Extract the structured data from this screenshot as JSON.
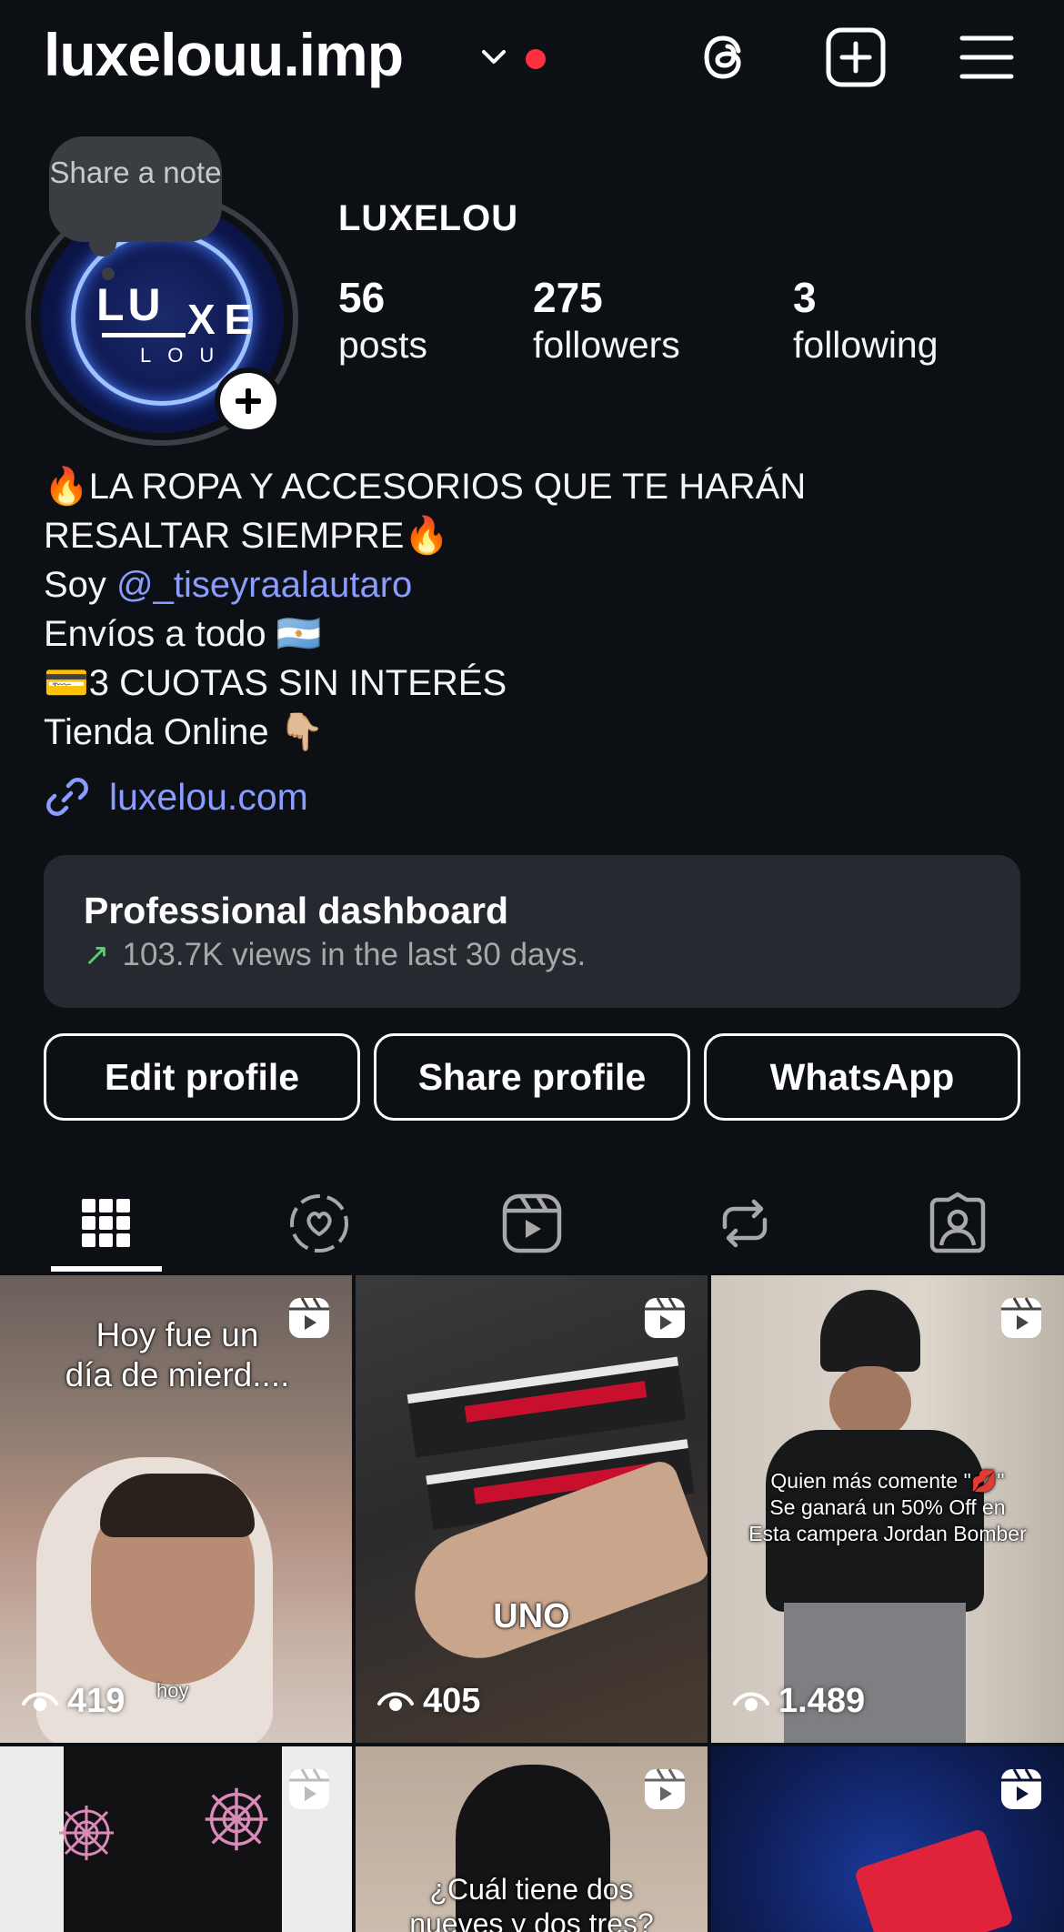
{
  "header": {
    "username": "luxelouu.imp",
    "icons": [
      "threads-icon",
      "create-post-icon",
      "menu-icon"
    ]
  },
  "note": {
    "text": "Share a note"
  },
  "avatar": {
    "logo_top": "LU",
    "logo_right": "XE",
    "logo_bottom": "LOU"
  },
  "profile": {
    "display_name": "LUXELOU",
    "stats": [
      {
        "value": "56",
        "label": "posts"
      },
      {
        "value": "275",
        "label": "followers"
      },
      {
        "value": "3",
        "label": "following"
      }
    ]
  },
  "bio": {
    "line1": "🔥LA ROPA Y ACCESORIOS QUE TE HARÁN",
    "line2": "RESALTAR SIEMPRE🔥",
    "line3_prefix": "Soy ",
    "mention": "@_tiseyraalautaro",
    "line4": "Envíos a todo 🇦🇷",
    "line5": "💳3 CUOTAS SIN INTERÉS",
    "line6": "Tienda Online 👇🏼",
    "link": "luxelou.com"
  },
  "dashboard": {
    "title": "Professional dashboard",
    "subtitle": "103.7K views in the last 30 days.",
    "accent": "#4fd46b"
  },
  "buttons": {
    "edit": "Edit profile",
    "share": "Share profile",
    "whatsapp": "WhatsApp"
  },
  "tabs": [
    "grid-icon",
    "reposts-heart-icon",
    "reels-icon",
    "reposts-icon",
    "tagged-icon"
  ],
  "grid": [
    {
      "caption": "Hoy fue un\ndía de mierd....",
      "views": "419",
      "tag": "hoy"
    },
    {
      "caption": "UNO",
      "views": "405"
    },
    {
      "caption": "Quien más comente \"💋\"\nSe ganará un 50% Off en\nEsta campera Jordan Bomber",
      "views": "1.489"
    },
    {
      "caption": ""
    },
    {
      "caption": "¿Cuál tiene dos\nnueves y dos tres?"
    },
    {
      "caption": ""
    }
  ],
  "colors": {
    "background": "#0c1014",
    "link": "#8a9cff",
    "notification": "#ff3040"
  }
}
